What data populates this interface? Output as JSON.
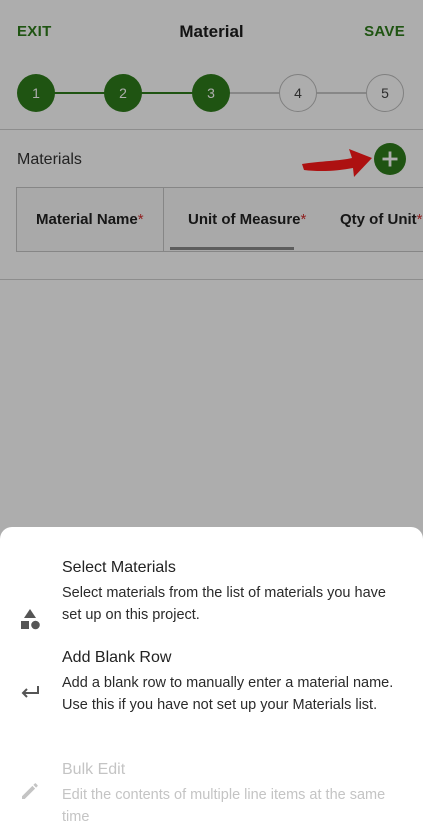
{
  "header": {
    "exit_label": "EXIT",
    "title": "Material",
    "save_label": "SAVE"
  },
  "stepper": {
    "steps": [
      "1",
      "2",
      "3",
      "4",
      "5"
    ],
    "completed": 3
  },
  "materials": {
    "label": "Materials",
    "add_icon": "plus-circle-icon",
    "annotation_icon": "red-arrow-icon",
    "columns": [
      {
        "label": "Material Name",
        "required_mark": "*"
      },
      {
        "label": "Unit of Measure",
        "required_mark": "*"
      },
      {
        "label": "Qty of Unit",
        "required_mark": "*"
      }
    ]
  },
  "sheet": {
    "options": [
      {
        "title": "Select Materials",
        "description": "Select materials from the list of materials you have set up on this project.",
        "icon": "shapes-icon",
        "enabled": true
      },
      {
        "title": "Add Blank Row",
        "description": "Add a blank row to manually enter a material name. Use this if you have not set up your Materials list.",
        "icon": "return-arrow-icon",
        "enabled": true
      },
      {
        "title": "Bulk Edit",
        "description": "Edit the contents of multiple line items at the same time",
        "icon": "pencil-icon",
        "enabled": false
      }
    ]
  },
  "colors": {
    "accent_green": "#2f7d1b",
    "required_red": "#d32f2f",
    "overlay": "rgba(0,0,0,0.32)"
  }
}
